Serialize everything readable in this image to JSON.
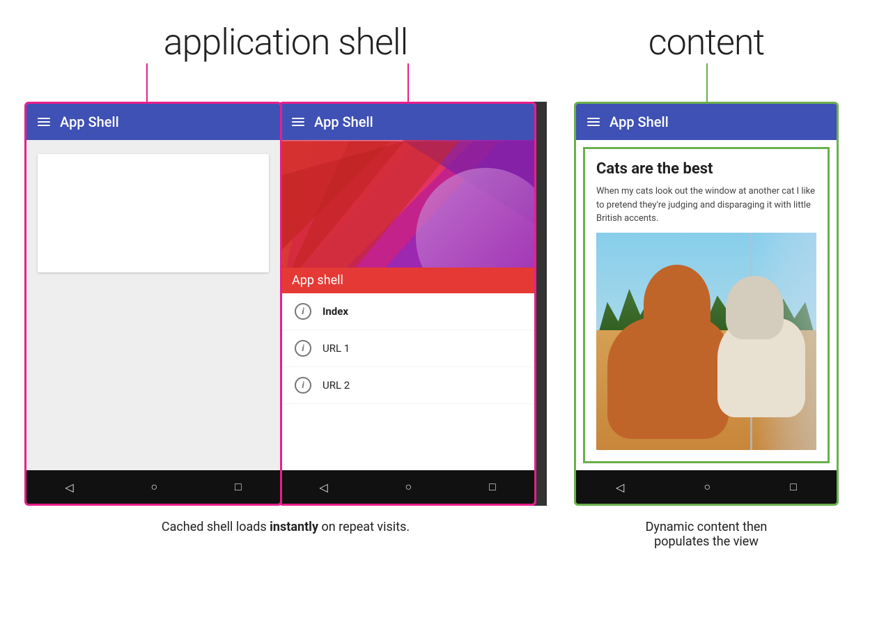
{
  "labels": {
    "app_shell_heading": "application shell",
    "content_heading": "content",
    "shell_overlay": "App shell",
    "app_bar_title_1": "App Shell",
    "app_bar_title_2": "App Shell",
    "app_bar_title_3": "App Shell"
  },
  "nav_items": [
    {
      "text": "Index",
      "bold": true
    },
    {
      "text": "URL 1",
      "bold": false
    },
    {
      "text": "URL 2",
      "bold": false
    }
  ],
  "content": {
    "title": "Cats are the best",
    "body": "When my cats look out the window at another cat I like to pretend they're judging and disparaging it with little British accents."
  },
  "captions": {
    "left": "Cached shell loads instantly on repeat visits.",
    "left_bold": "instantly",
    "right_line1": "Dynamic content then",
    "right_line2": "populates the view"
  },
  "android_nav": {
    "back": "◁",
    "home": "○",
    "recent": "□"
  },
  "colors": {
    "pink_border": "#e91e8c",
    "green_border": "#6ab04c",
    "app_bar": "#3f51b5",
    "android_nav": "#111111"
  }
}
